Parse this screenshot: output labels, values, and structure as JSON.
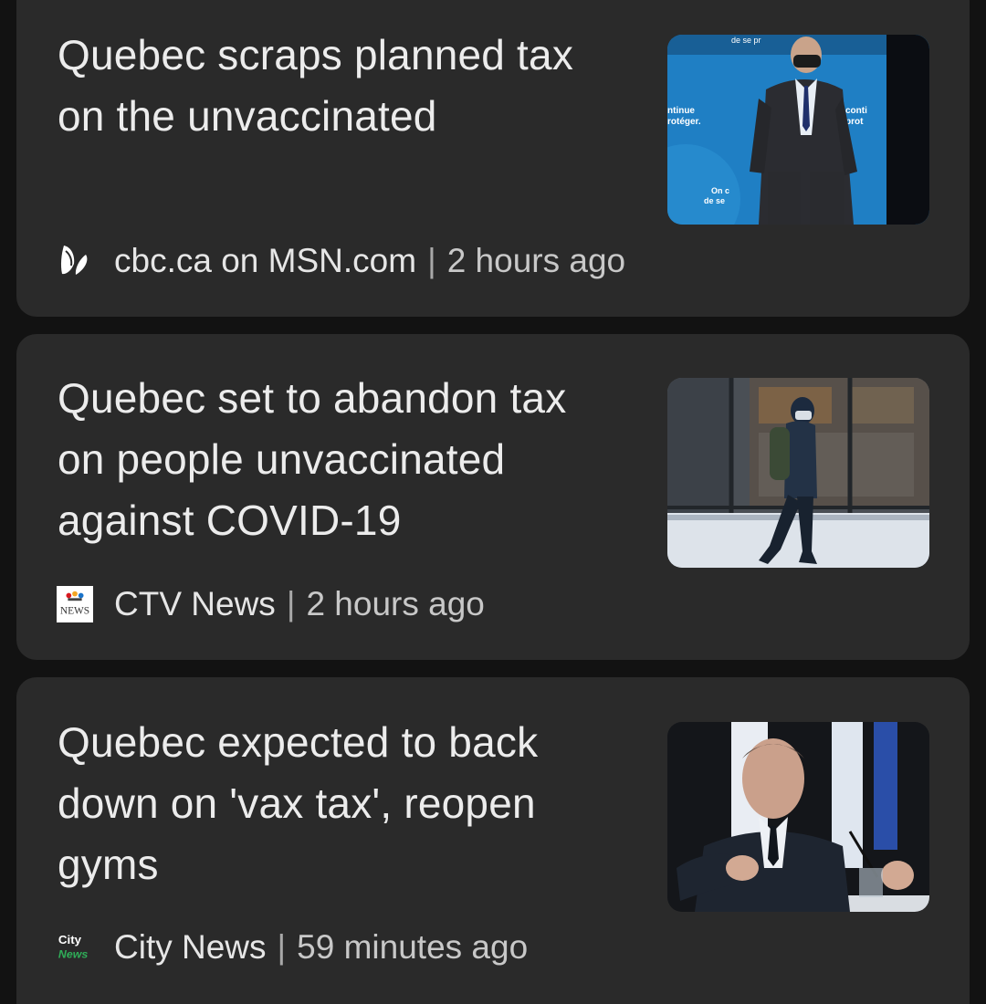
{
  "articles": [
    {
      "headline_lines": [
        "Quebec scraps planned tax",
        "on the unvaccinated"
      ],
      "source": "cbc.ca on MSN.com",
      "separator": "|",
      "time": "2 hours ago",
      "logo_icon": "msn-butterfly-icon",
      "image_text": {
        "top": "de se pr",
        "left_1": "ntinue",
        "left_2": "rotéger.",
        "right_1": "conti",
        "right_2": "prot",
        "bottom_1": "On c",
        "bottom_2": "de se"
      }
    },
    {
      "headline_lines": [
        "Quebec set to abandon tax",
        "on people unvaccinated",
        "against COVID-19"
      ],
      "source": "CTV News",
      "separator": "|",
      "time": "2 hours ago",
      "logo_icon": "ctv-news-logo-icon",
      "logo_text": "NEWS"
    },
    {
      "headline_lines": [
        "Quebec expected to back",
        "down on 'vax tax', reopen",
        "gyms"
      ],
      "source": "City News",
      "separator": "|",
      "time": "59 minutes ago",
      "logo_icon": "citynews-logo-icon",
      "logo_text_1": "City",
      "logo_text_2": "News"
    }
  ],
  "colors": {
    "background": "#121212",
    "card": "#2a2a2a",
    "headline": "#ececec",
    "meta": "#d4d4d4"
  }
}
